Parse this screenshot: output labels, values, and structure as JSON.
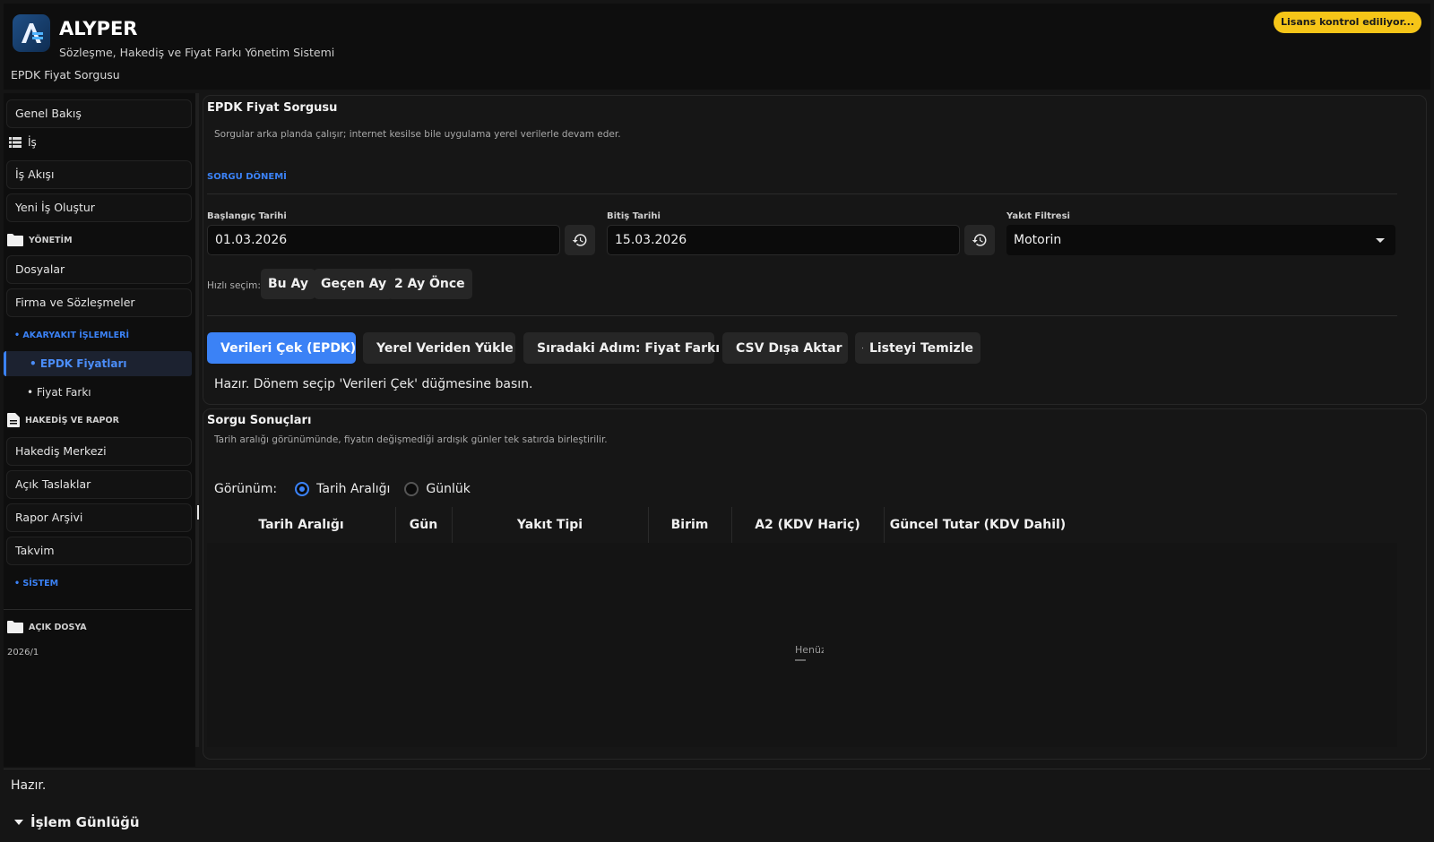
{
  "app": {
    "title": "ALYPER",
    "subtitle": "Sözleşme, Hakediş ve Fiyat Farkı Yönetim Sistemi",
    "breadcrumb": "EPDK Fiyat Sorgusu",
    "license_status": "Lisans kontrol ediliyor...",
    "brand_color": "#3b82f6",
    "badge_color": "#f5c518"
  },
  "sidebar": {
    "overview": "Genel Bakış",
    "work_header": "İş",
    "workflow": "İş Akışı",
    "new_job": "Yeni İş Oluştur",
    "management_header": "YÖNETİM",
    "files": "Dosyalar",
    "companies": "Firma ve Sözleşmeler",
    "fuel_header": "• AKARYAKIT İŞLEMLERİ",
    "epdk_prices": "• EPDK Fiyatları",
    "price_diff": "• Fiyat Farkı",
    "report_header": "HAKEDİŞ VE RAPOR",
    "payment_center": "Hakediş Merkezi",
    "open_drafts": "Açık Taslaklar",
    "report_archive": "Rapor Arşivi",
    "calendar": "Takvim",
    "system_header": "• SİSTEM",
    "open_file_header": "AÇIK DOSYA",
    "open_file_value": "2026/1"
  },
  "query": {
    "title": "EPDK Fiyat Sorgusu",
    "description": "Sorgular arka planda çalışır; internet kesilse bile uygulama yerel verilerle devam eder.",
    "period_label": "SORGU DÖNEMİ",
    "start_label": "Başlangıç Tarihi",
    "start_value": "01.03.2026",
    "end_label": "Bitiş Tarihi",
    "end_value": "15.03.2026",
    "fuel_label": "Yakıt Filtresi",
    "fuel_value": "Motorin",
    "quick_label": "Hızlı seçim:",
    "quick_this_month": "Bu Ay",
    "quick_last_month": "Geçen Ay",
    "quick_two_months": "2 Ay Önce",
    "fetch": "Verileri Çek (EPDK)",
    "load_local": "Yerel Veriden Yükle",
    "next_step": "Sıradaki Adım: Fiyat Farkı",
    "export_csv": "CSV Dışa Aktar",
    "clear_list": "Listeyi Temizle",
    "status": "Hazır. Dönem seçip 'Verileri Çek' düğmesine basın."
  },
  "results": {
    "title": "Sorgu Sonuçları",
    "description": "Tarih aralığı görünümünde, fiyatın değişmediği ardışık günler tek satırda birleştirilir.",
    "view_label": "Görünüm:",
    "view_range": "Tarih Aralığı",
    "view_daily": "Günlük",
    "columns": [
      "Tarih Aralığı",
      "Gün",
      "Yakıt Tipi",
      "Birim",
      "A2 (KDV Hariç)",
      "Güncel Tutar (KDV Dahil)"
    ],
    "empty_text": "Henüz"
  },
  "footer": {
    "status": "Hazır.",
    "log_title": "İşlem Günlüğü"
  }
}
